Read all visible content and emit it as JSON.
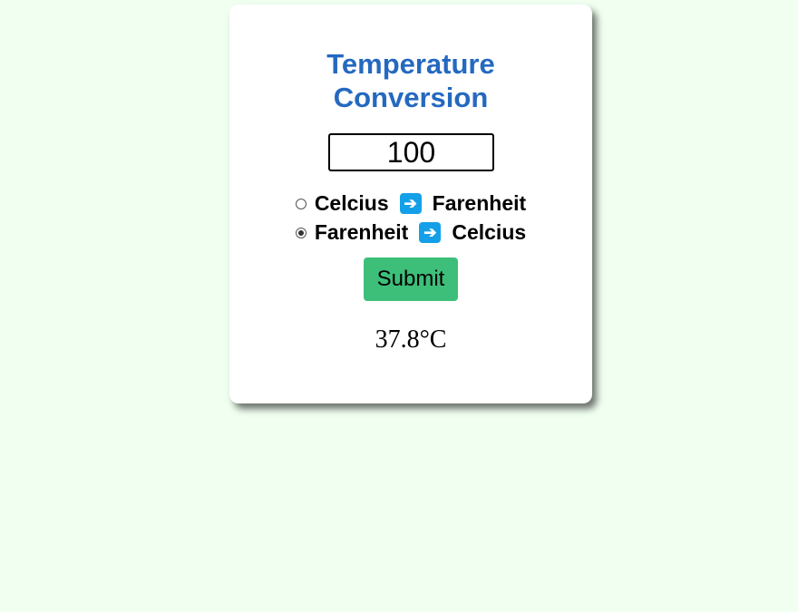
{
  "converter": {
    "title_line1": "Temperature",
    "title_line2": "Conversion",
    "input_value": "100",
    "options": [
      {
        "from": "Celcius",
        "arrow_icon": "right-arrow-emoji",
        "to": "Farenheit",
        "checked": false
      },
      {
        "from": "Farenheit",
        "arrow_icon": "right-arrow-emoji",
        "to": "Celcius",
        "checked": true
      }
    ],
    "submit_label": "Submit",
    "result": "37.8°C"
  },
  "colors": {
    "page_background": "#f0fff0",
    "title": "#2469c0",
    "submit_button": "#3dbf7a",
    "arrow_badge": "#14a0e8"
  }
}
